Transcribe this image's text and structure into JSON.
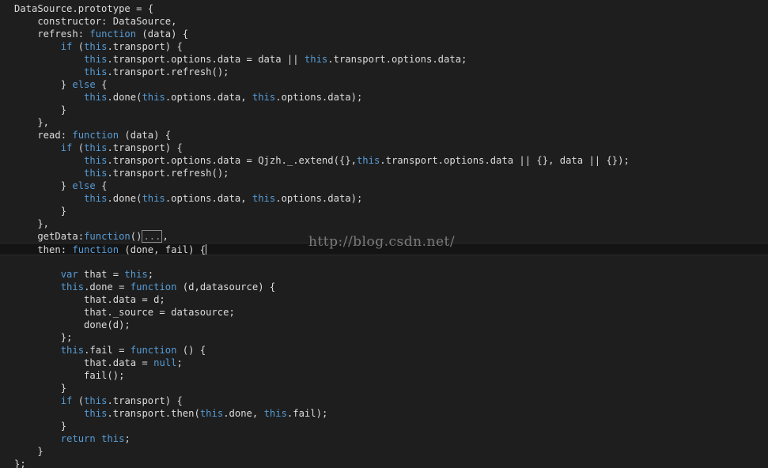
{
  "editor": {
    "language": "javascript",
    "theme_colors": {
      "background": "#1e1e1e",
      "text": "#dcdcdc",
      "keyword": "#569cd6"
    },
    "lines": [
      [
        [
          "p",
          "DataSource.prototype = {"
        ]
      ],
      [
        [
          "p",
          "    constructor: DataSource,"
        ]
      ],
      [
        [
          "p",
          "    refresh: "
        ],
        [
          "k",
          "function"
        ],
        [
          "p",
          " (data) {"
        ]
      ],
      [
        [
          "p",
          "        "
        ],
        [
          "k",
          "if"
        ],
        [
          "p",
          " ("
        ],
        [
          "k",
          "this"
        ],
        [
          "p",
          ".transport) {"
        ]
      ],
      [
        [
          "p",
          "            "
        ],
        [
          "k",
          "this"
        ],
        [
          "p",
          ".transport.options.data = data || "
        ],
        [
          "k",
          "this"
        ],
        [
          "p",
          ".transport.options.data;"
        ]
      ],
      [
        [
          "p",
          "            "
        ],
        [
          "k",
          "this"
        ],
        [
          "p",
          ".transport.refresh();"
        ]
      ],
      [
        [
          "p",
          "        } "
        ],
        [
          "k",
          "else"
        ],
        [
          "p",
          " {"
        ]
      ],
      [
        [
          "p",
          "            "
        ],
        [
          "k",
          "this"
        ],
        [
          "p",
          ".done("
        ],
        [
          "k",
          "this"
        ],
        [
          "p",
          ".options.data, "
        ],
        [
          "k",
          "this"
        ],
        [
          "p",
          ".options.data);"
        ]
      ],
      [
        [
          "p",
          "        }"
        ]
      ],
      [
        [
          "p",
          "    },"
        ]
      ],
      [
        [
          "p",
          "    read: "
        ],
        [
          "k",
          "function"
        ],
        [
          "p",
          " (data) {"
        ]
      ],
      [
        [
          "p",
          "        "
        ],
        [
          "k",
          "if"
        ],
        [
          "p",
          " ("
        ],
        [
          "k",
          "this"
        ],
        [
          "p",
          ".transport) {"
        ]
      ],
      [
        [
          "p",
          "            "
        ],
        [
          "k",
          "this"
        ],
        [
          "p",
          ".transport.options.data = Qjzh._.extend({},"
        ],
        [
          "k",
          "this"
        ],
        [
          "p",
          ".transport.options.data || {}, data || {});"
        ]
      ],
      [
        [
          "p",
          "            "
        ],
        [
          "k",
          "this"
        ],
        [
          "p",
          ".transport.refresh();"
        ]
      ],
      [
        [
          "p",
          "        } "
        ],
        [
          "k",
          "else"
        ],
        [
          "p",
          " {"
        ]
      ],
      [
        [
          "p",
          "            "
        ],
        [
          "k",
          "this"
        ],
        [
          "p",
          ".done("
        ],
        [
          "k",
          "this"
        ],
        [
          "p",
          ".options.data, "
        ],
        [
          "k",
          "this"
        ],
        [
          "p",
          ".options.data);"
        ]
      ],
      [
        [
          "p",
          "        }"
        ]
      ],
      [
        [
          "p",
          "    },"
        ]
      ],
      [
        [
          "p",
          "    getData:"
        ],
        [
          "k",
          "function"
        ],
        [
          "p",
          "()"
        ],
        [
          "c",
          "..."
        ],
        [
          "p",
          ","
        ]
      ],
      [
        [
          "p",
          "    then: "
        ],
        [
          "k",
          "function"
        ],
        [
          "p",
          " (done, fail) {"
        ],
        [
          "cursor",
          ""
        ]
      ],
      [
        [
          "p",
          ""
        ]
      ],
      [
        [
          "p",
          "        "
        ],
        [
          "k",
          "var"
        ],
        [
          "p",
          " that = "
        ],
        [
          "k",
          "this"
        ],
        [
          "p",
          ";"
        ]
      ],
      [
        [
          "p",
          "        "
        ],
        [
          "k",
          "this"
        ],
        [
          "p",
          ".done = "
        ],
        [
          "k",
          "function"
        ],
        [
          "p",
          " (d,datasource) {"
        ]
      ],
      [
        [
          "p",
          "            that.data = d;"
        ]
      ],
      [
        [
          "p",
          "            that._source = datasource;"
        ]
      ],
      [
        [
          "p",
          "            done(d);"
        ]
      ],
      [
        [
          "p",
          "        };"
        ]
      ],
      [
        [
          "p",
          "        "
        ],
        [
          "k",
          "this"
        ],
        [
          "p",
          ".fail = "
        ],
        [
          "k",
          "function"
        ],
        [
          "p",
          " () {"
        ]
      ],
      [
        [
          "p",
          "            that.data = "
        ],
        [
          "k",
          "null"
        ],
        [
          "p",
          ";"
        ]
      ],
      [
        [
          "p",
          "            fail();"
        ]
      ],
      [
        [
          "p",
          "        }"
        ]
      ],
      [
        [
          "p",
          "        "
        ],
        [
          "k",
          "if"
        ],
        [
          "p",
          " ("
        ],
        [
          "k",
          "this"
        ],
        [
          "p",
          ".transport) {"
        ]
      ],
      [
        [
          "p",
          "            "
        ],
        [
          "k",
          "this"
        ],
        [
          "p",
          ".transport.then("
        ],
        [
          "k",
          "this"
        ],
        [
          "p",
          ".done, "
        ],
        [
          "k",
          "this"
        ],
        [
          "p",
          ".fail);"
        ]
      ],
      [
        [
          "p",
          "        }"
        ]
      ],
      [
        [
          "p",
          "        "
        ],
        [
          "k",
          "return"
        ],
        [
          "p",
          " "
        ],
        [
          "k",
          "this"
        ],
        [
          "p",
          ";"
        ]
      ],
      [
        [
          "p",
          "    }"
        ]
      ],
      [
        [
          "p",
          "};"
        ]
      ]
    ],
    "current_line_index": 19,
    "collapsed_region_label": "..."
  },
  "watermark": {
    "text": "http://blog.csdn.net/"
  }
}
